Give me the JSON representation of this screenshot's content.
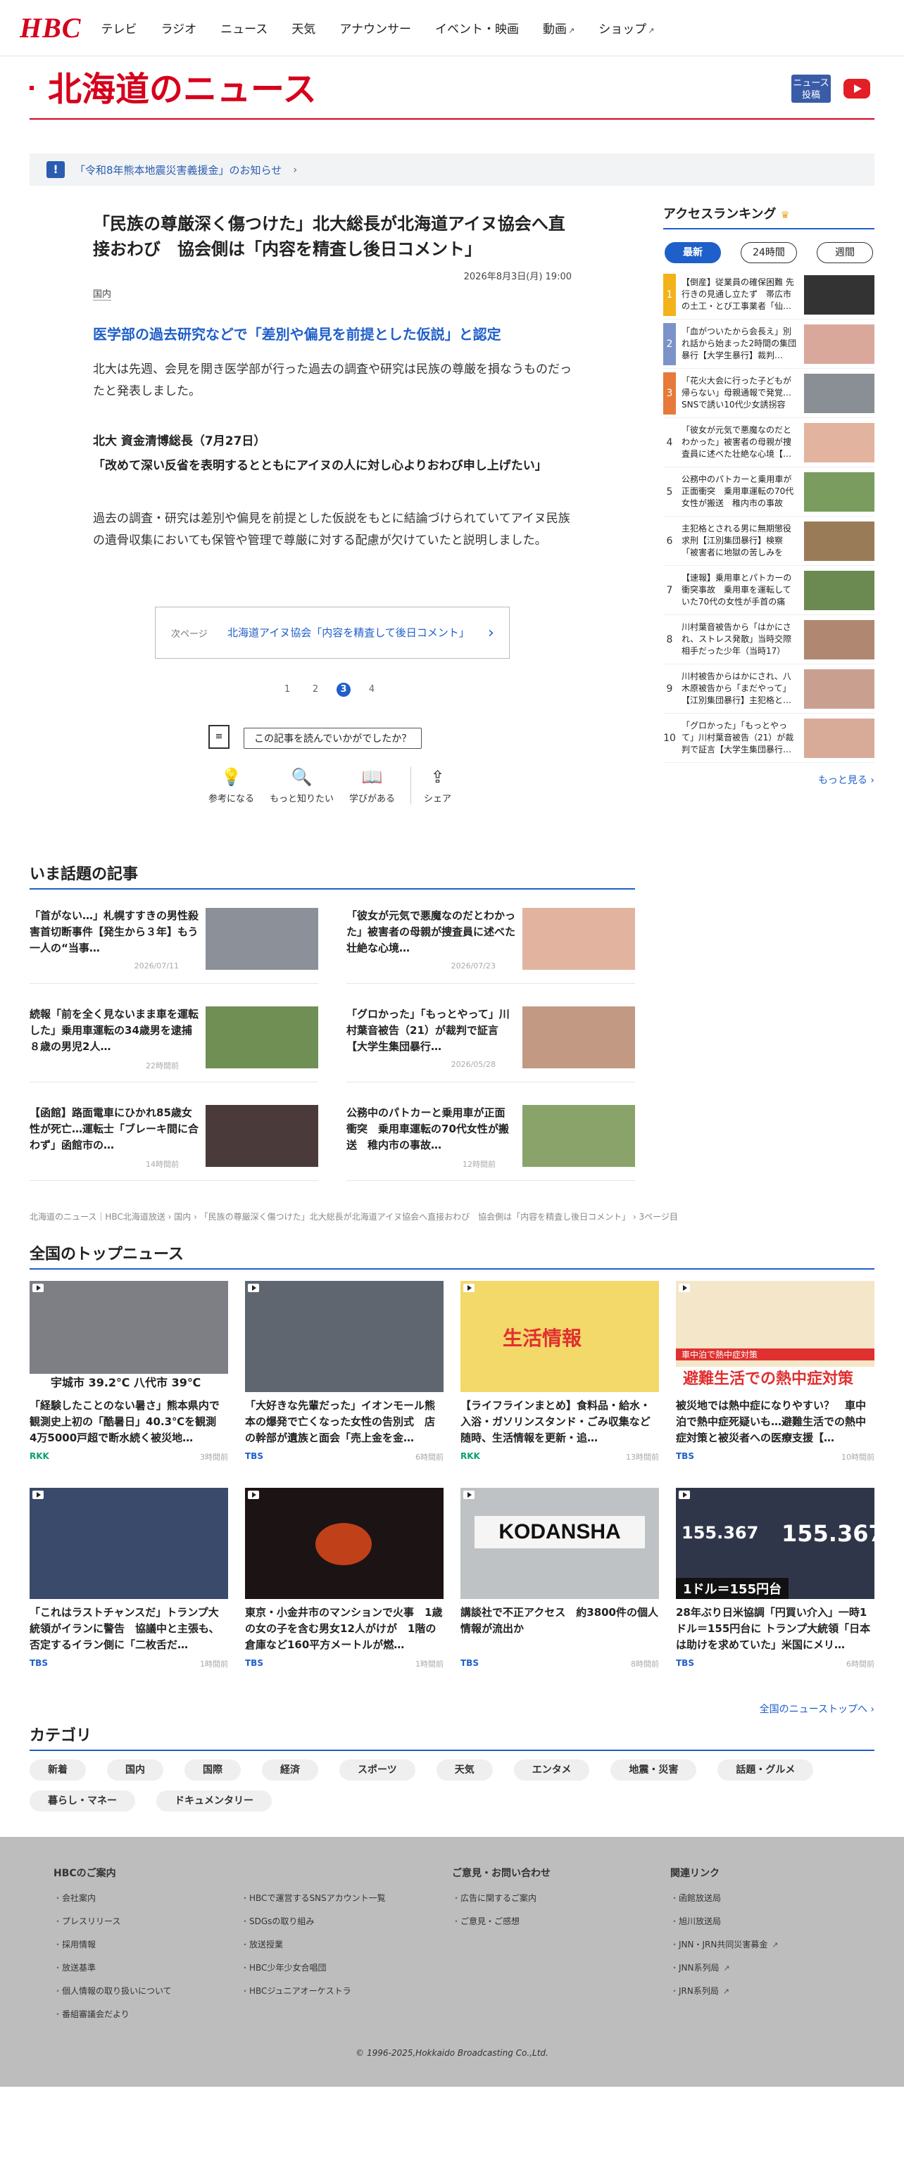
{
  "header": {
    "logo": "HBC",
    "nav": [
      {
        "label": "テレビ"
      },
      {
        "label": "ラジオ"
      },
      {
        "label": "ニュース"
      },
      {
        "label": "天気"
      },
      {
        "label": "アナウンサー"
      },
      {
        "label": "イベント・映画"
      },
      {
        "label": "動画",
        "external": true
      },
      {
        "label": "ショップ",
        "external": true
      }
    ]
  },
  "page": {
    "title": "北海道のニュース",
    "post_button": "ニュース\n投稿"
  },
  "notice": {
    "icon": "!",
    "text": "「令和8年熊本地震災害義援金」のお知らせ"
  },
  "article": {
    "title": "「民族の尊厳深く傷つけた」北大総長が北海道アイヌ協会へ直接おわび　協会側は「内容を精査し後日コメント」",
    "date": "2026年8月3日(月) 19:00",
    "category": "国内",
    "subheading": "医学部の過去研究などで「差別や偏見を前提とした仮説」と認定",
    "p1": "北大は先週、会見を開き医学部が行った過去の調査や研究は民族の尊厳を損なうものだったと発表しました。",
    "quote_name": "北大 資金清博総長（7月27日）",
    "quote": "「改めて深い反省を表明するとともにアイヌの人に対し心よりおわび申し上げたい」",
    "p2": "過去の調査・研究は差別や偏見を前提とした仮説をもとに結論づけられていてアイヌ民族の遺骨収集においても保管や管理で尊厳に対する配慮が欠けていたと説明しました。"
  },
  "next": {
    "label": "次ページ",
    "text": "北海道アイヌ協会「内容を精査して後日コメント」"
  },
  "pager": [
    "1",
    "2",
    "3",
    "4"
  ],
  "feedback": {
    "question": "この記事を読んでいかがでしたか？",
    "actions": [
      {
        "icon": "💡",
        "label": "参考になる"
      },
      {
        "icon": "🔍",
        "label": "もっと知りたい"
      },
      {
        "icon": "📖",
        "label": "学びがある"
      },
      {
        "icon": "⇪",
        "label": "シェア"
      }
    ]
  },
  "ranking": {
    "title": "アクセスランキング",
    "tabs": [
      "最新",
      "24時間",
      "週間"
    ],
    "items": [
      {
        "n": "1",
        "text": "【倒産】従業員の確保困難 先行きの見通し立たず　帯広市の土工・とび工事業者「仙…"
      },
      {
        "n": "2",
        "text": "「血がついたから会長え」別れ話から始まった2時間の集団暴行【大学生暴行】裁判…"
      },
      {
        "n": "3",
        "text": "「花火大会に行った子どもが帰らない」母親通報で発覚…SNSで誘い10代少女誘拐容疑　…"
      },
      {
        "n": "4",
        "text": "「彼女が元気で悪魔なのだとわかった」被害者の母親が捜査員に述べた壮絶な心境【…"
      },
      {
        "n": "5",
        "text": "公務中のパトカーと乗用車が正面衝突　乗用車運転の70代女性が搬送　稚内市の事故現…"
      },
      {
        "n": "6",
        "text": "主犯格とされる男に無期懲役求刑【江別集団暴行】検察「被害者に地獄の苦しみを与…"
      },
      {
        "n": "7",
        "text": "【速報】乗用車とパトカーの衝突事故　乗用車を運転していた70代の女性が手首の痛み…"
      },
      {
        "n": "8",
        "text": "川村葉音被告から「はかにされ、ストレス発散」当時交際相手だった少年（当時17）が…"
      },
      {
        "n": "9",
        "text": "川村被告からはかにされ、八木原被告から「まだやって」【江別集団暴行】主犯格と…"
      },
      {
        "n": "10",
        "text": "「グロかった」「もっとやって」川村葉音被告（21）が裁判で証言【大学生集団暴行…"
      }
    ],
    "more": "もっと見る ›"
  },
  "topics": {
    "title": "いま話題の記事",
    "items": [
      {
        "text": "「首がない…」札幌すすきの男性殺害首切断事件【発生から３年】もう一人の“当事…",
        "date": "2026/07/11"
      },
      {
        "text": "「彼女が元気で悪魔なのだとわかった」被害者の母親が捜査員に述べた壮絶な心境…",
        "date": "2026/07/23"
      },
      {
        "text": "続報「前を全く見ないまま車を運転した」乗用車運転の34歳男を逮捕　８歳の男児2人…",
        "date": "22時間前"
      },
      {
        "text": "「グロかった」「もっとやって」川村葉音被告（21）が裁判で証言【大学生集団暴行…",
        "date": "2026/05/28"
      },
      {
        "text": "【函館】路面電車にひかれ85歳女性が死亡…運転士「ブレーキ間に合わず」函館市の…",
        "date": "14時間前"
      },
      {
        "text": "公務中のパトカーと乗用車が正面衝突　乗用車運転の70代女性が搬送　稚内市の事故…",
        "date": "12時間前"
      }
    ]
  },
  "breadcrumb": "北海道のニュース｜HBC北海道放送 › 国内 › 「民族の尊厳深く傷つけた」北大総長が北海道アイヌ協会へ直接おわび　協会側は「内容を精査し後日コメント」 › 3ページ目",
  "national": {
    "title": "全国のトップニュース",
    "items": [
      {
        "text": "「経験したことのない暑さ」熊本県内で観測史上初の「酷暑日」40.3℃を観測　4万5000戸超で断水続く被災地…",
        "src": "RKK",
        "ago": "3時間前"
      },
      {
        "text": "「大好きな先輩だった」イオンモール熊本の爆発で亡くなった女性の告別式　店の幹部が遺族と面会「売上金を金…",
        "src": "TBS",
        "ago": "6時間前"
      },
      {
        "text": "【ライフラインまとめ】食料品・給水・入浴・ガソリンスタンド・ごみ収集など　随時、生活情報を更新・追…",
        "src": "RKK",
        "ago": "13時間前"
      },
      {
        "text": "被災地では熱中症になりやすい？　車中泊で熱中症死疑いも…避難生活での熱中症対策と被災者への医療支援【…",
        "src": "TBS",
        "ago": "10時間前"
      },
      {
        "text": "「これはラストチャンスだ」トランプ大統領がイランに警告　協議中と主張も、否定するイラン側に「二枚舌だ…",
        "src": "TBS",
        "ago": "1時間前"
      },
      {
        "text": "東京・小金井市のマンションで火事　1歳の女の子を含む男女12人がけが　1階の倉庫など160平方メートルが燃…",
        "src": "TBS",
        "ago": "1時間前"
      },
      {
        "text": "講談社で不正アクセス　約3800件の個人情報が流出か",
        "src": "TBS",
        "ago": "8時間前"
      },
      {
        "text": "28年ぶり日米協調「円買い介入」一時1ドル＝155円台に トランプ大統領「日本は助けを求めていた」米国にメリ…",
        "src": "TBS",
        "ago": "6時間前"
      }
    ],
    "more": "全国のニューストップへ ›",
    "img_text": {
      "a": "宇城市 39.2℃ 八代市 39℃",
      "c": "生活情報",
      "d1": "車中泊で熱中症対策",
      "d2": "避難生活での熱中症対策",
      "f": "KODANSHA",
      "g1": "155.367",
      "g2": "155.367",
      "g3": "1ドル＝155円台"
    }
  },
  "categories": {
    "title": "カテゴリ",
    "items": [
      "新着",
      "国内",
      "国際",
      "経済",
      "スポーツ",
      "天気",
      "エンタメ",
      "地震・災害",
      "話題・グルメ",
      "暮らし・マネー",
      "ドキュメンタリー"
    ]
  },
  "footer": {
    "col1": {
      "head": "HBCのご案内",
      "items": [
        "会社案内",
        "プレスリリース",
        "採用情報",
        "放送基準",
        "個人情報の取り扱いについて",
        "番組審議会だより"
      ]
    },
    "col2": {
      "head": "",
      "items": [
        "HBCで運営するSNSアカウント一覧",
        "SDGsの取り組み",
        "放送授業",
        "HBC少年少女合唱団",
        "HBCジュニアオーケストラ"
      ]
    },
    "col3": {
      "head": "ご意見・お問い合わせ",
      "items": [
        "広告に関するご案内",
        "ご意見・ご感想"
      ]
    },
    "col4": {
      "head": "関連リンク",
      "items": [
        "函館放送局",
        "旭川放送局",
        "JNN・JRN共同災害募金",
        "JNN系列局",
        "JRN系列局"
      ]
    },
    "copyright": "© 1996-2025,Hokkaido Broadcasting Co.,Ltd."
  }
}
